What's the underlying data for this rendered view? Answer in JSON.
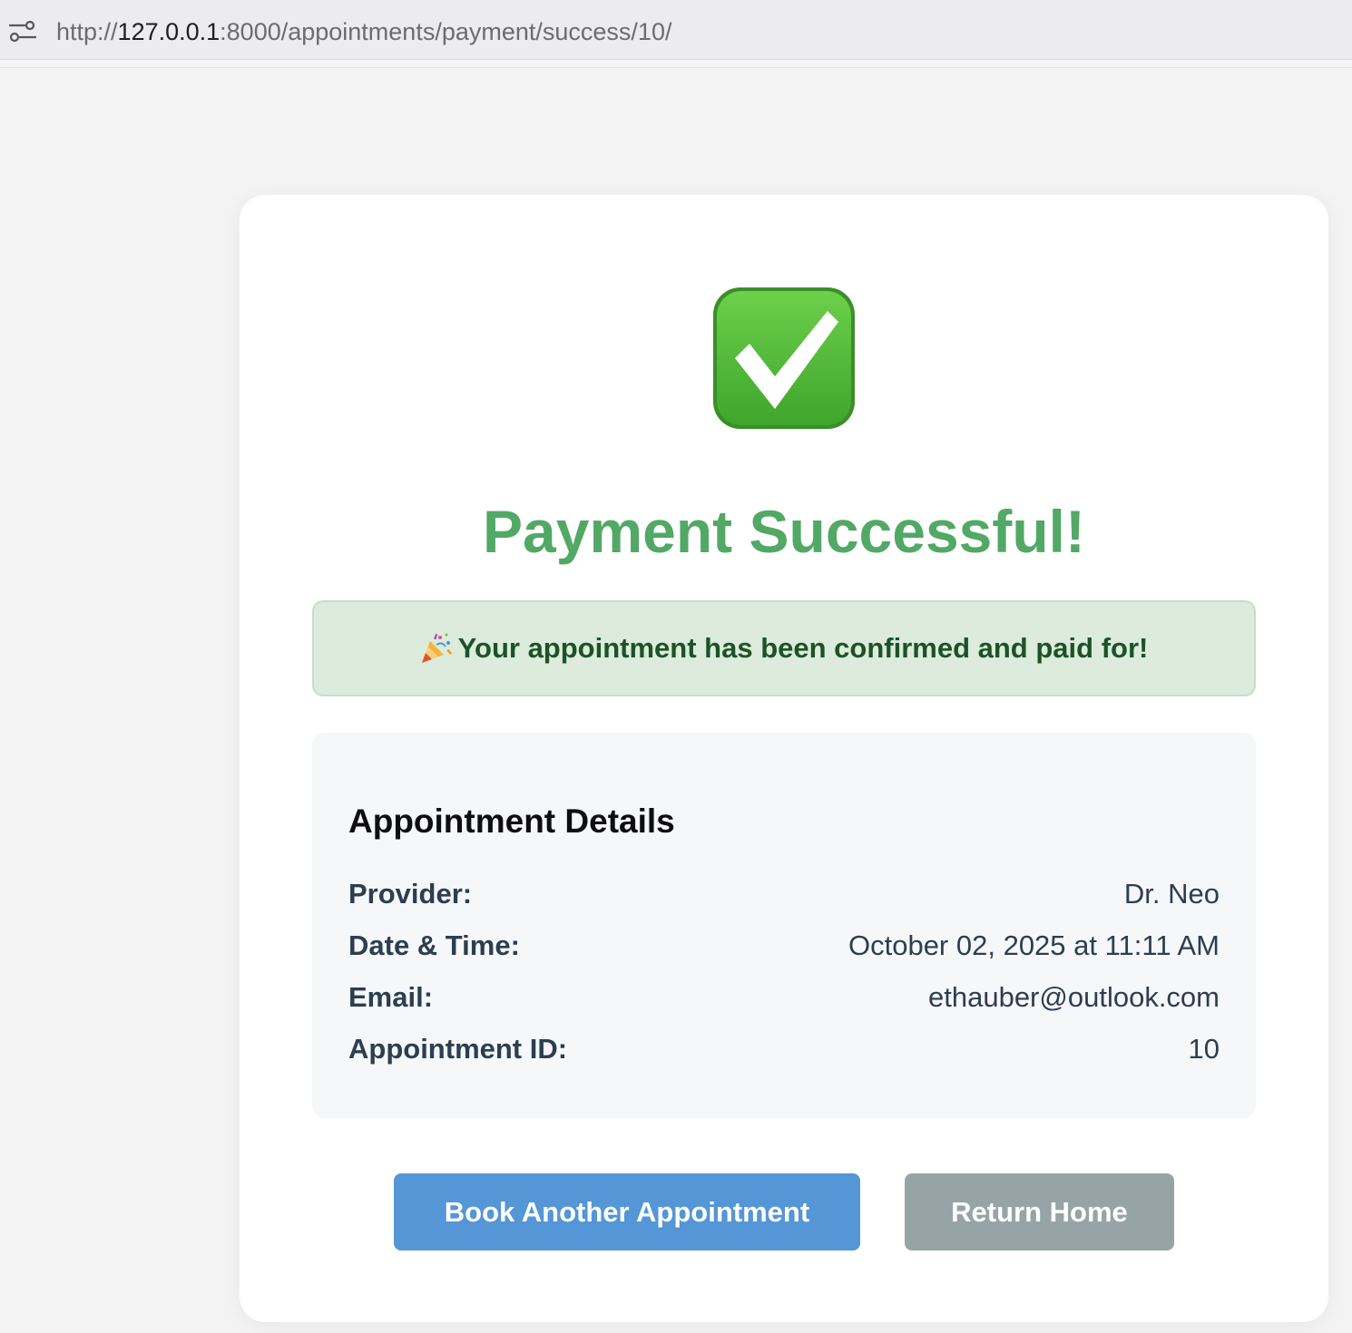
{
  "browser": {
    "url_prefix": "http://",
    "url_host": "127.0.0.1",
    "url_rest": ":8000/appointments/payment/success/10/",
    "site_info_icon": "tune-icon"
  },
  "page": {
    "status_icon": "check-mark-button-icon",
    "title": "Payment Successful!",
    "alert": {
      "icon": "party-popper-icon",
      "text": "Your appointment has been confirmed and paid for!"
    },
    "details": {
      "heading": "Appointment Details",
      "rows": [
        {
          "label": "Provider:",
          "value": "Dr. Neo"
        },
        {
          "label": "Date & Time:",
          "value": "October 02, 2025 at 11:11 AM"
        },
        {
          "label": "Email:",
          "value": "ethauber@outlook.com"
        },
        {
          "label": "Appointment ID:",
          "value": "10"
        }
      ]
    },
    "buttons": {
      "book_another": "Book Another Appointment",
      "return_home": "Return Home"
    }
  },
  "colors": {
    "title_green": "#52a865",
    "alert_bg": "#dcebdc",
    "alert_text": "#1c5326",
    "primary_button": "#5496d6",
    "secondary_button": "#97a4a6"
  }
}
